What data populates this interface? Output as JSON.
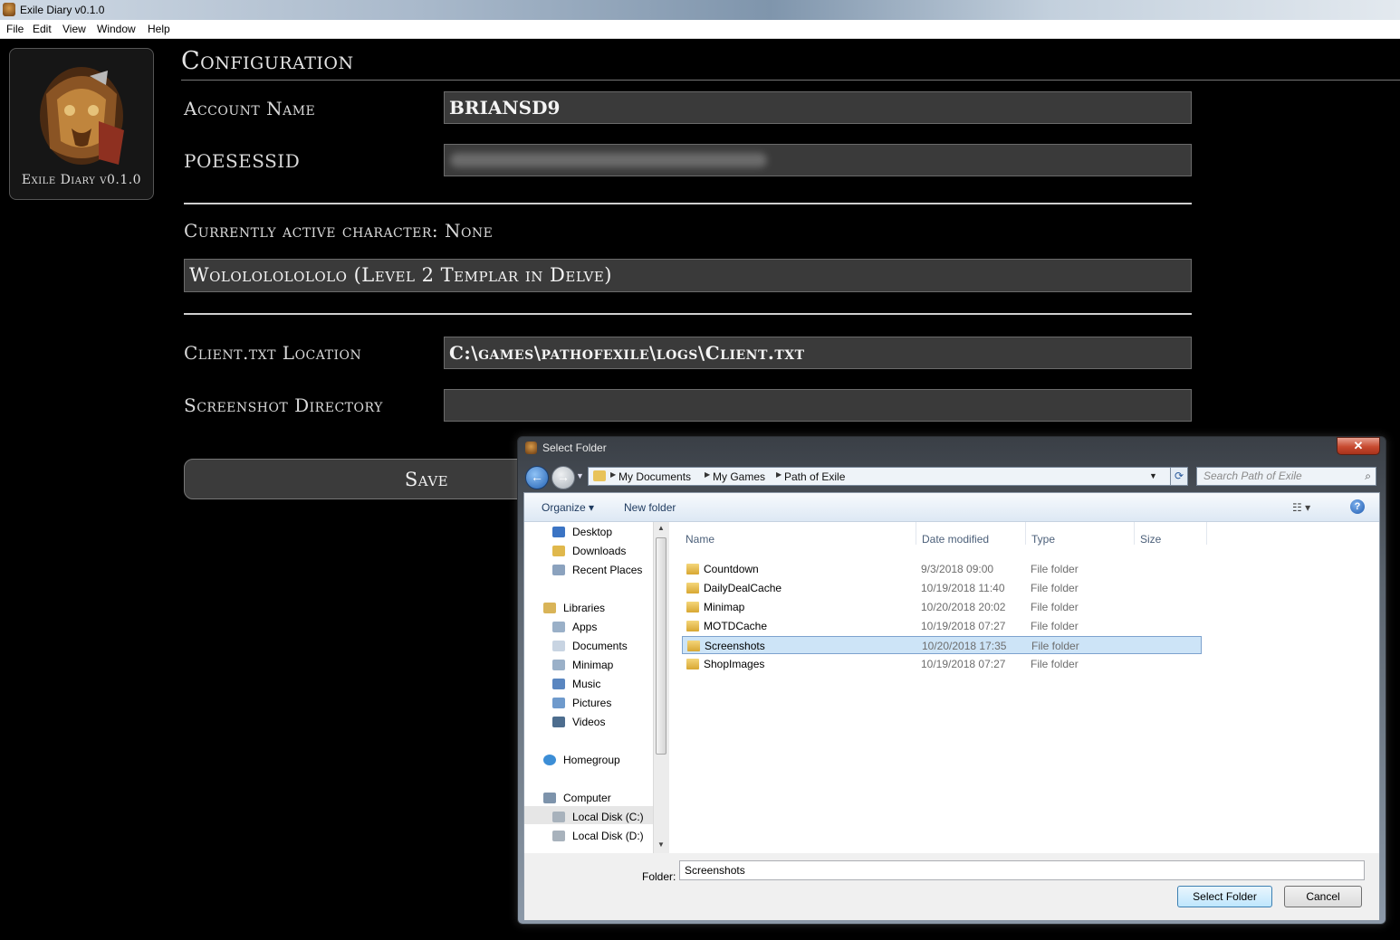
{
  "window": {
    "title": "Exile Diary v0.1.0"
  },
  "menu": [
    "File",
    "Edit",
    "View",
    "Window",
    "Help"
  ],
  "logo": {
    "caption": "Exile Diary v0.1.0"
  },
  "config": {
    "title": "Configuration",
    "account_label": "Account Name",
    "account_value": "BRIANSD9",
    "poesessid_label": "POESESSID",
    "active_character_label": "Currently active character: None",
    "character_value": "Wololololololo (Level 2 Templar in Delve)",
    "client_label": "Client.txt Location",
    "client_value": "C:\\games\\pathofexile\\logs\\Client.txt",
    "screenshot_label": "Screenshot Directory",
    "screenshot_value": "",
    "save_label": "Save"
  },
  "dialog": {
    "title": "Select Folder",
    "close_label": "✕",
    "breadcrumb": [
      "My Documents",
      "My Games",
      "Path of Exile"
    ],
    "search_placeholder": "Search Path of Exile",
    "toolbar": {
      "organize": "Organize ▾",
      "new_folder": "New folder"
    },
    "nav": {
      "desktop": "Desktop",
      "downloads": "Downloads",
      "recent": "Recent Places",
      "libraries": "Libraries",
      "apps": "Apps",
      "documents": "Documents",
      "minimap": "Minimap",
      "music": "Music",
      "pictures": "Pictures",
      "videos": "Videos",
      "homegroup": "Homegroup",
      "computer": "Computer",
      "local_c": "Local Disk (C:)",
      "local_d": "Local Disk (D:)"
    },
    "columns": {
      "name": "Name",
      "date": "Date modified",
      "type": "Type",
      "size": "Size"
    },
    "files": [
      {
        "name": "Countdown",
        "date": "9/3/2018 09:00",
        "type": "File folder"
      },
      {
        "name": "DailyDealCache",
        "date": "10/19/2018 11:40",
        "type": "File folder"
      },
      {
        "name": "Minimap",
        "date": "10/20/2018 20:02",
        "type": "File folder"
      },
      {
        "name": "MOTDCache",
        "date": "10/19/2018 07:27",
        "type": "File folder"
      },
      {
        "name": "Screenshots",
        "date": "10/20/2018 17:35",
        "type": "File folder"
      },
      {
        "name": "ShopImages",
        "date": "10/19/2018 07:27",
        "type": "File folder"
      }
    ],
    "folder_label": "Folder:",
    "folder_value": "Screenshots",
    "select_label": "Select Folder",
    "cancel_label": "Cancel"
  }
}
